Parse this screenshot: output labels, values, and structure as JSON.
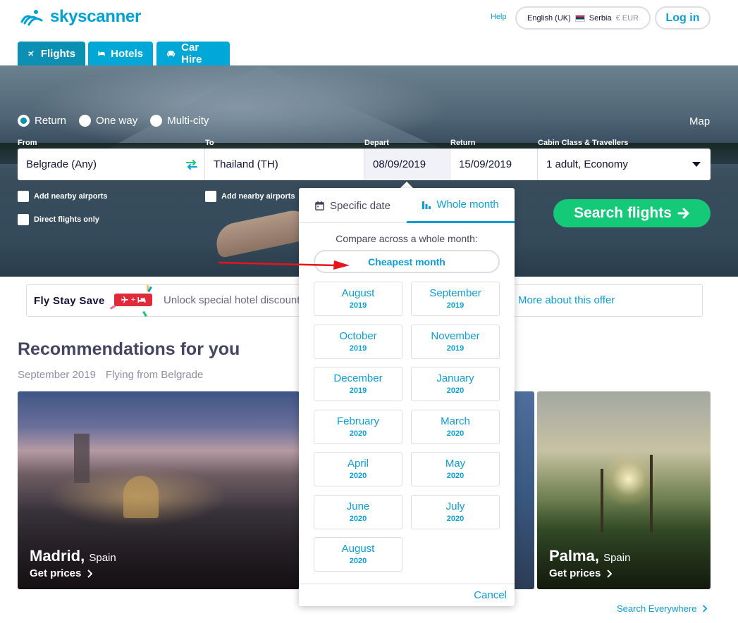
{
  "header": {
    "logo_text": "skyscanner",
    "help": "Help",
    "language": "English (UK)",
    "country": "Serbia",
    "currency": "€ EUR",
    "login": "Log in"
  },
  "tabs": [
    {
      "label": "Flights",
      "icon": "plane-icon",
      "active": true
    },
    {
      "label": "Hotels",
      "icon": "bed-icon",
      "active": false
    },
    {
      "label": "Car Hire",
      "icon": "car-icon",
      "active": false
    }
  ],
  "trip_type": {
    "options": [
      "Return",
      "One way",
      "Multi-city"
    ],
    "selected": "Return"
  },
  "map_link": "Map",
  "search": {
    "from_label": "From",
    "from_value": "Belgrade (Any)",
    "to_label": "To",
    "to_value": "Thailand (TH)",
    "depart_label": "Depart",
    "depart_value": "08/09/2019",
    "return_label": "Return",
    "return_value": "15/09/2019",
    "cabin_label": "Cabin Class & Travellers",
    "cabin_value": "1 adult, Economy",
    "nearby_from": "Add nearby airports",
    "nearby_to": "Add nearby airports",
    "direct_only": "Direct flights only",
    "button": "Search flights"
  },
  "date_picker": {
    "tab_specific": "Specific date",
    "tab_whole": "Whole month",
    "active_tab": "Whole month",
    "compare_text": "Compare across a whole month:",
    "cheapest": "Cheapest month",
    "months": [
      {
        "name": "August",
        "year": "2019"
      },
      {
        "name": "September",
        "year": "2019"
      },
      {
        "name": "October",
        "year": "2019"
      },
      {
        "name": "November",
        "year": "2019"
      },
      {
        "name": "December",
        "year": "2019"
      },
      {
        "name": "January",
        "year": "2020"
      },
      {
        "name": "February",
        "year": "2020"
      },
      {
        "name": "March",
        "year": "2020"
      },
      {
        "name": "April",
        "year": "2020"
      },
      {
        "name": "May",
        "year": "2020"
      },
      {
        "name": "June",
        "year": "2020"
      },
      {
        "name": "July",
        "year": "2020"
      },
      {
        "name": "August",
        "year": "2020"
      }
    ],
    "cancel": "Cancel"
  },
  "promo": {
    "title": "Fly Stay Save",
    "badge_plus": "+",
    "text": "Unlock special hotel discount",
    "more": "More about this offer"
  },
  "recommendations": {
    "title": "Recommendations for you",
    "month": "September 2019",
    "origin": "Flying from Belgrade",
    "cards": [
      {
        "city": "Madrid,",
        "country": "Spain",
        "cta": "Get prices"
      },
      {
        "city": "Palma,",
        "country": "Spain",
        "cta": "Get prices"
      }
    ],
    "search_everywhere": "Search Everywhere"
  },
  "colors": {
    "brand": "#00a2d3",
    "link": "#0b9ed8",
    "tab_active": "#0b8fb3",
    "search_button": "#14c977",
    "annotation_arrow": "#e8141c"
  }
}
